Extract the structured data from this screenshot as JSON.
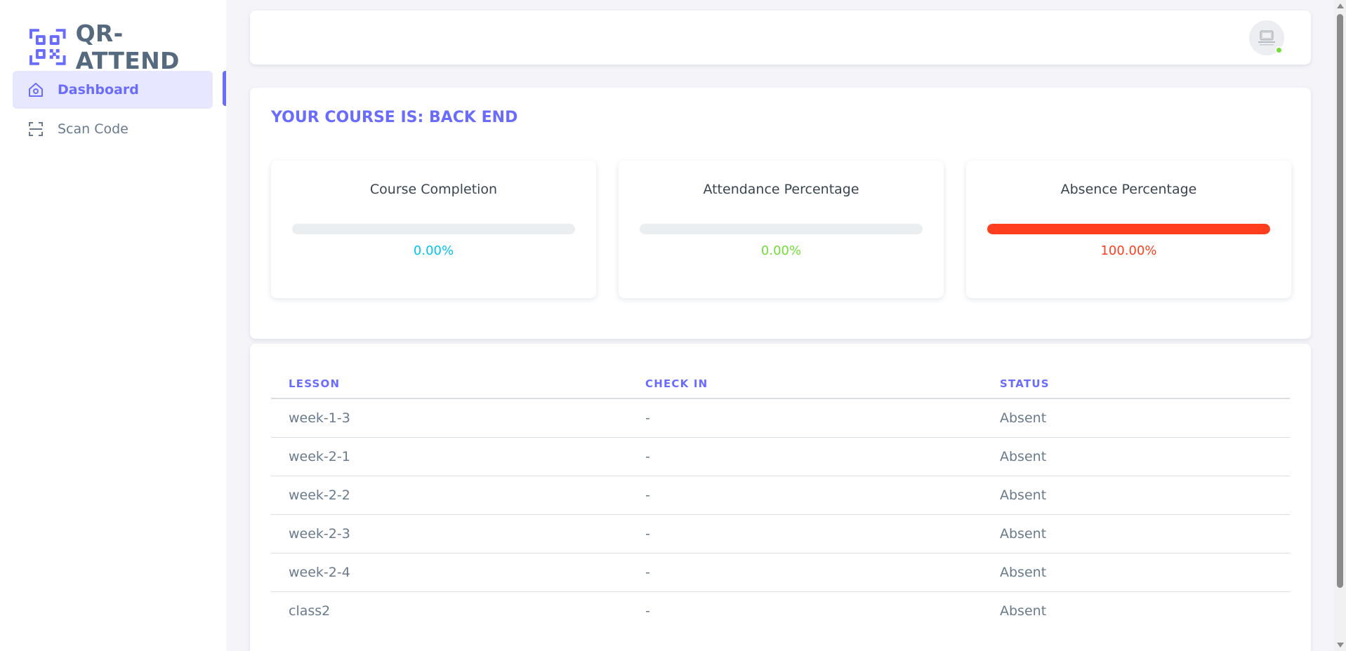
{
  "app": {
    "name": "QR-ATTEND",
    "brand_color": "#696cff"
  },
  "sidebar": {
    "items": [
      {
        "label": "Dashboard",
        "icon": "home-icon",
        "active": true
      },
      {
        "label": "Scan Code",
        "icon": "scan-icon",
        "active": false
      }
    ]
  },
  "navbar": {
    "avatar_icon": "avatar-placeholder-icon",
    "online_status_color": "#71dd37"
  },
  "course": {
    "title": "YOUR COURSE IS: BACK END",
    "stats": [
      {
        "title": "Course Completion",
        "value": "0.00%",
        "progress": 0,
        "color": "#03c3ec"
      },
      {
        "title": "Attendance Percentage",
        "value": "0.00%",
        "progress": 0,
        "color": "#71dd37"
      },
      {
        "title": "Absence Percentage",
        "value": "100.00%",
        "progress": 100,
        "color": "#ff3e1d"
      }
    ]
  },
  "table": {
    "headers": [
      "LESSON",
      "CHECK IN",
      "STATUS"
    ],
    "rows": [
      [
        "week-1-3",
        "-",
        "Absent"
      ],
      [
        "week-2-1",
        "-",
        "Absent"
      ],
      [
        "week-2-2",
        "-",
        "Absent"
      ],
      [
        "week-2-3",
        "-",
        "Absent"
      ],
      [
        "week-2-4",
        "-",
        "Absent"
      ],
      [
        "class2",
        "-",
        "Absent"
      ]
    ]
  }
}
